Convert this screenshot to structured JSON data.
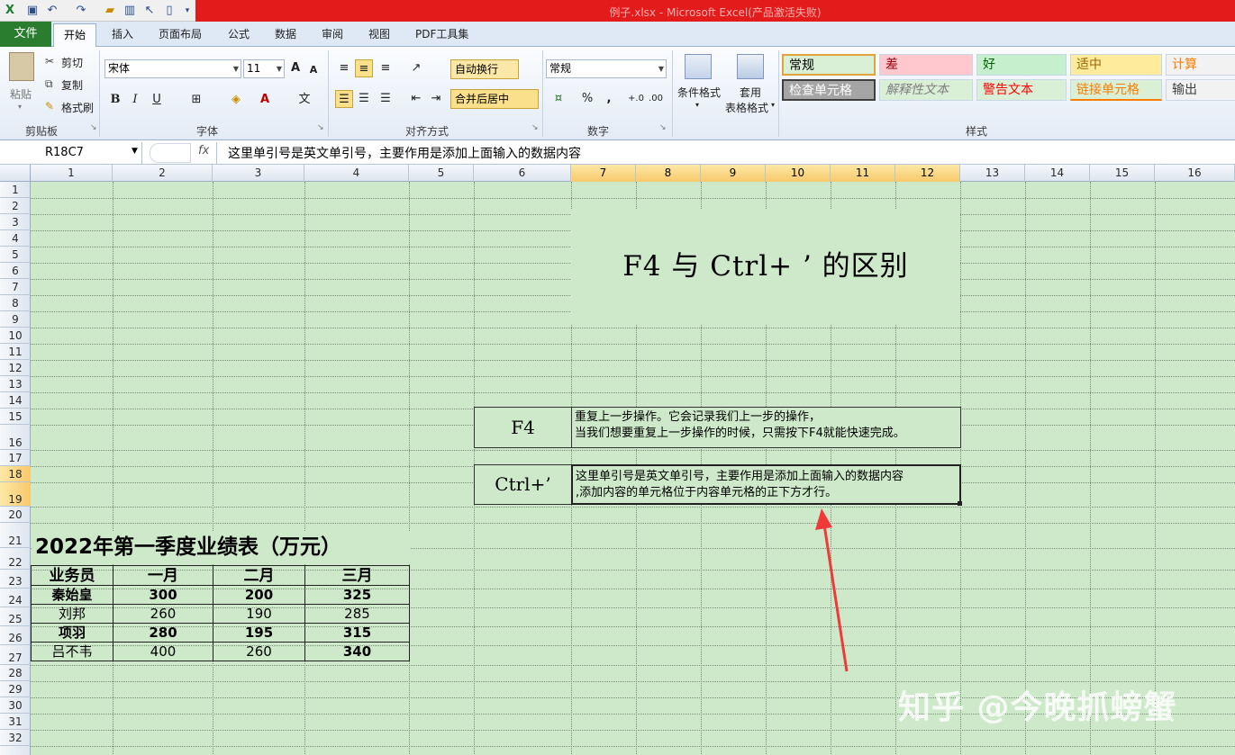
{
  "window": {
    "title": "例子.xlsx - Microsoft Excel(产品激活失败)"
  },
  "tabs": {
    "file": "文件",
    "items": [
      "开始",
      "插入",
      "页面布局",
      "公式",
      "数据",
      "审阅",
      "视图",
      "PDF工具集"
    ]
  },
  "ribbon": {
    "clipboard": {
      "paste": "粘贴",
      "cut": "剪切",
      "copy": "复制",
      "format_painter": "格式刷",
      "label": "剪贴板"
    },
    "font": {
      "name": "宋体",
      "size": "11",
      "label": "字体",
      "bold": "B",
      "italic": "I",
      "underline": "U"
    },
    "alignment": {
      "wrap_text": "自动换行",
      "merge_center": "合并后居中",
      "label": "对齐方式"
    },
    "number": {
      "format": "常规",
      "percent": "%",
      "comma": ",",
      "label": "数字"
    },
    "styles_cmds": {
      "conditional": "条件格式",
      "table_format_1": "套用",
      "table_format_2": "表格格式",
      "label": "样式"
    },
    "styles": [
      {
        "name": "常规",
        "bg": "#d9efd6",
        "color": "#000000"
      },
      {
        "name": "差",
        "bg": "#ffc7ce",
        "color": "#9c0006"
      },
      {
        "name": "好",
        "bg": "#c6efce",
        "color": "#006100"
      },
      {
        "name": "适中",
        "bg": "#ffeb9c",
        "color": "#9c6500"
      },
      {
        "name": "计算",
        "bg": "#f2f2f2",
        "color": "#fa7d00"
      },
      {
        "name": "检查单元格",
        "bg": "#a5a5a5",
        "color": "#ffffff"
      },
      {
        "name": "解释性文本",
        "bg": "#d9efd6",
        "color": "#7f7f7f"
      },
      {
        "name": "警告文本",
        "bg": "#d9efd6",
        "color": "#ff0000"
      },
      {
        "name": "链接单元格",
        "bg": "#d9efd6",
        "color": "#fa7d00"
      },
      {
        "name": "输出",
        "bg": "#f2f2f2",
        "color": "#3f3f3f"
      }
    ]
  },
  "formula_bar": {
    "name_box": "R18C7",
    "fx": "fx",
    "content": "这里单引号是英文单引号，主要作用是添加上面输入的数据内容"
  },
  "columns": [
    "1",
    "2",
    "3",
    "4",
    "5",
    "6",
    "7",
    "8",
    "9",
    "10",
    "11",
    "12",
    "13",
    "14",
    "15",
    "16"
  ],
  "rows": [
    "1",
    "2",
    "3",
    "4",
    "5",
    "6",
    "7",
    "8",
    "9",
    "10",
    "11",
    "12",
    "13",
    "14",
    "15",
    "16",
    "17",
    "18",
    "19",
    "20",
    "21",
    "22",
    "23",
    "24",
    "25",
    "26",
    "27",
    "28",
    "29",
    "30",
    "31",
    "32"
  ],
  "sheet": {
    "title": "F4 与 Ctrl+ ’ 的区别",
    "f4_label": "F4",
    "f4_desc_1": "重复上一步操作。它会记录我们上一步的操作，",
    "f4_desc_2": "当我们想要重复上一步操作的时候，只需按下F4就能快速完成。",
    "ctrl_label": "Ctrl+’",
    "ctrl_desc_1": "这里单引号是英文单引号，主要作用是添加上面输入的数据内容",
    "ctrl_desc_2": ",添加内容的单元格位于内容单元格的正下方才行。",
    "table_title": "2022年第一季度业绩表（万元）",
    "table_headers": [
      "业务员",
      "一月",
      "二月",
      "三月"
    ],
    "table_rows": [
      [
        "秦始皇",
        "300",
        "200",
        "325"
      ],
      [
        "刘邦",
        "260",
        "190",
        "285"
      ],
      [
        "项羽",
        "280",
        "195",
        "315"
      ],
      [
        "吕不韦",
        "400",
        "260",
        "340"
      ]
    ]
  },
  "watermark": "知乎 @今晚抓螃蟹"
}
